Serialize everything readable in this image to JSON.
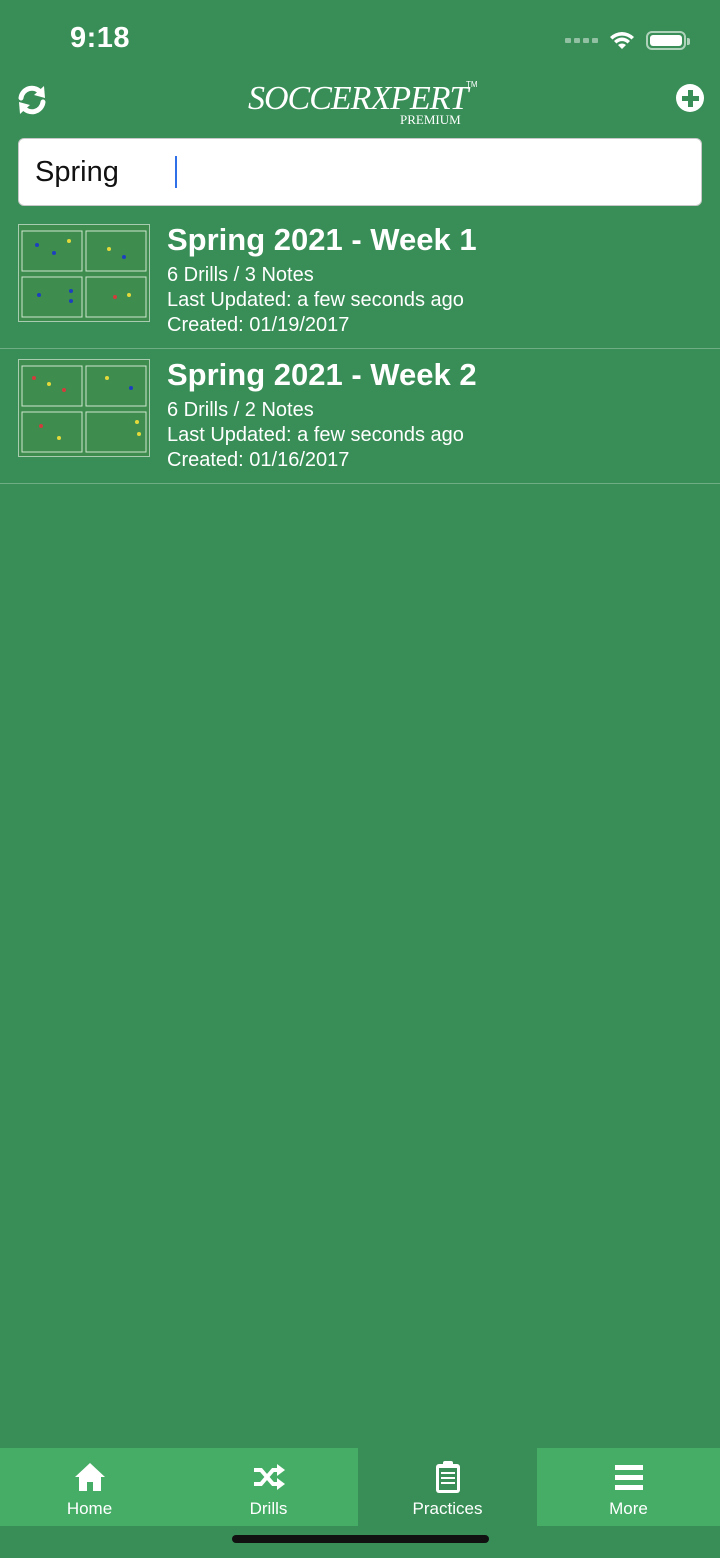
{
  "status_bar": {
    "time": "9:18"
  },
  "header": {
    "logo_main": "SOCCERXPERT",
    "logo_sub": "PREMIUM",
    "logo_tm": "TM",
    "refresh_icon": "refresh-icon",
    "add_icon": "plus-circle-icon"
  },
  "search": {
    "value": "Spring"
  },
  "practices": [
    {
      "title": "Spring 2021 - Week 1",
      "counts": "6 Drills / 3 Notes",
      "updated": "Last Updated: a few seconds ago",
      "created": "Created: 01/19/2017"
    },
    {
      "title": "Spring 2021 - Week 2",
      "counts": "6 Drills / 2 Notes",
      "updated": "Last Updated: a few seconds ago",
      "created": "Created: 01/16/2017"
    }
  ],
  "tabs": [
    {
      "label": "Home",
      "icon": "home-icon"
    },
    {
      "label": "Drills",
      "icon": "shuffle-icon"
    },
    {
      "label": "Practices",
      "icon": "clipboard-icon",
      "active": true
    },
    {
      "label": "More",
      "icon": "menu-icon"
    }
  ],
  "colors": {
    "background": "#388e56",
    "tab": "#46ad67",
    "caret": "#2f6fe8"
  }
}
